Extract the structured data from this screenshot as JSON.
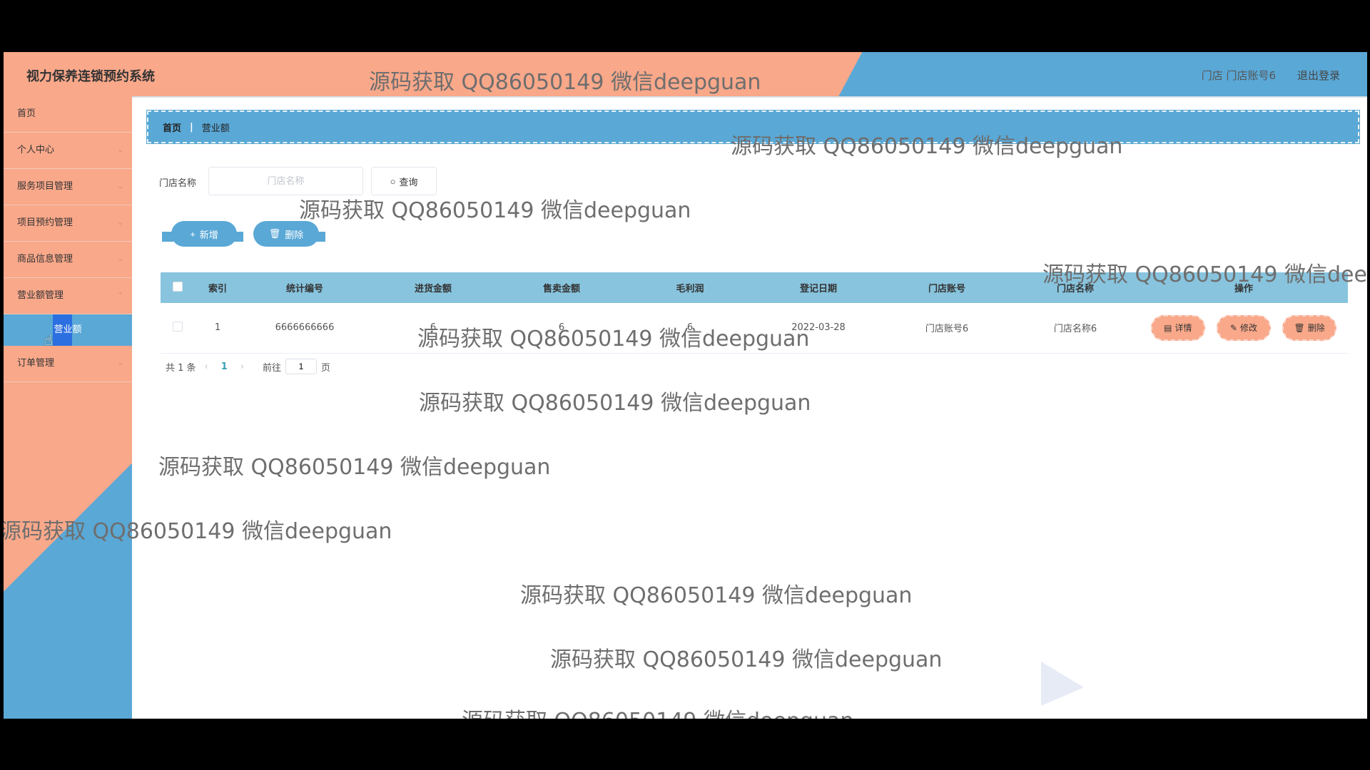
{
  "header": {
    "app_title": "视力保养连锁预约系统",
    "user_info": "门店 门店账号6",
    "logout_label": "退出登录"
  },
  "sidebar": {
    "items": [
      {
        "label": "首页"
      },
      {
        "label": "个人中心"
      },
      {
        "label": "服务项目管理"
      },
      {
        "label": "项目预约管理"
      },
      {
        "label": "商品信息管理"
      },
      {
        "label": "营业额管理"
      },
      {
        "label": "订单管理"
      }
    ],
    "active_sub": "营业额"
  },
  "breadcrumb": {
    "home": "首页",
    "current": "营业额"
  },
  "search": {
    "label": "门店名称",
    "placeholder": "门店名称",
    "button_label": "查询"
  },
  "actions": {
    "add_label": "新增",
    "delete_label": "删除"
  },
  "table": {
    "headers": [
      "索引",
      "统计编号",
      "进货金额",
      "售卖金额",
      "毛利润",
      "登记日期",
      "门店账号",
      "门店名称",
      "操作"
    ],
    "rows": [
      {
        "index": "1",
        "code": "6666666666",
        "purchase": "6",
        "sales": "6",
        "profit": "6",
        "date": "2022-03-28",
        "account": "门店账号6",
        "store": "门店名称6"
      }
    ],
    "row_actions": {
      "detail": "详情",
      "edit": "修改",
      "delete": "删除"
    }
  },
  "pagination": {
    "total": "共 1 条",
    "current_page": "1",
    "goto_prefix": "前往",
    "goto_value": "1",
    "goto_suffix": "页"
  },
  "watermark": "源码获取 QQ86050149 微信deepguan",
  "colors": {
    "salmon": "#f9a88a",
    "blue": "#5aa8d6",
    "table_header": "#88c4de",
    "active_submenu": "#2b6fe0"
  }
}
